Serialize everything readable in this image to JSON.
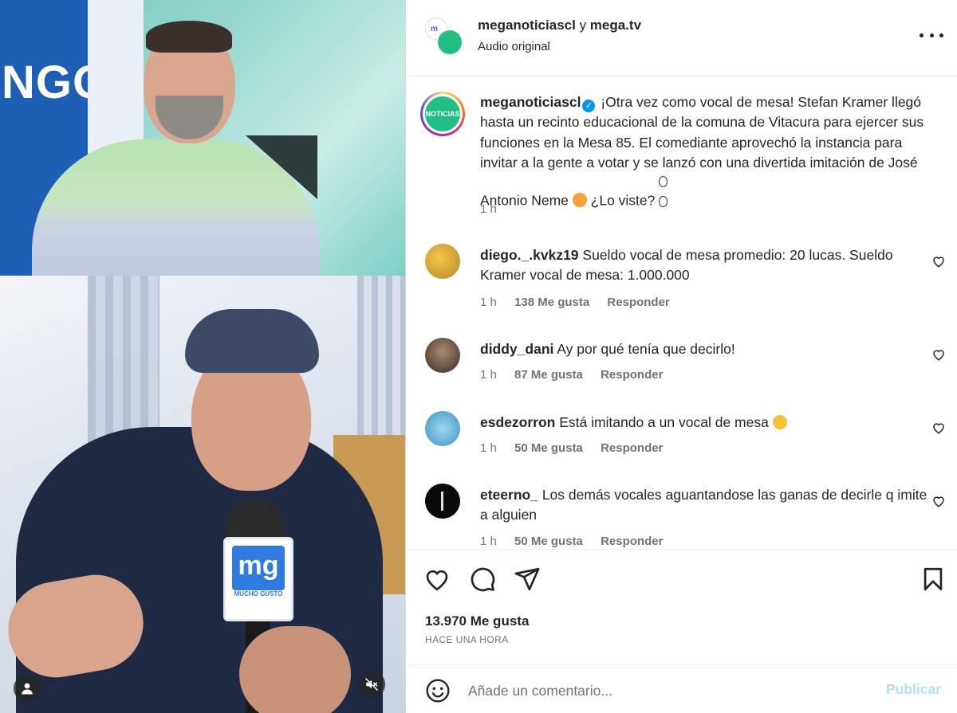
{
  "media": {
    "top_scene_text": "NGO",
    "mic_logo": "mg",
    "mic_sub": "MUCHO GUSTO",
    "user_icon": "user-icon",
    "mute_icon": "muted-speaker-icon"
  },
  "header": {
    "collab_avatar_text": "m",
    "user1": "meganoticiascl",
    "separator": "y",
    "user2": "mega.tv",
    "audio": "Audio original",
    "more_icon": "more-options-icon"
  },
  "caption": {
    "avatar_text": "NOTICIAS",
    "username": "meganoticiascl",
    "text_part1": "¡Otra vez como vocal de mesa! Stefan Kramer llegó hasta un recinto educacional de la comuna de Vitacura para ejercer sus funciones en la Mesa 85. El comediante aprovechó la instancia para invitar a la gente a votar y se lanzó con una divertida imitación de José Antonio Neme",
    "text_part2": "¿Lo viste?",
    "time": "1 h"
  },
  "comments": [
    {
      "username": "diego._.kvkz19",
      "text": "Sueldo vocal de mesa promedio: 20 lucas. Sueldo Kramer vocal de mesa: 1.000.000",
      "time": "1 h",
      "likes": "138 Me gusta",
      "reply": "Responder"
    },
    {
      "username": "diddy_dani",
      "text": "Ay por qué tenía que decirlo!",
      "time": "1 h",
      "likes": "87 Me gusta",
      "reply": "Responder"
    },
    {
      "username": "esdezorron",
      "text": "Está imitando a un vocal de mesa",
      "time": "1 h",
      "likes": "50 Me gusta",
      "reply": "Responder"
    },
    {
      "username": "eteerno_",
      "text": "Los demás vocales aguantandose las ganas de decirle q imite a alguien",
      "time": "1 h",
      "likes": "50 Me gusta",
      "reply": "Responder"
    }
  ],
  "actions": {
    "like_icon": "heart-icon",
    "comment_icon": "comment-icon",
    "share_icon": "send-icon",
    "save_icon": "bookmark-icon",
    "likes": "13.970 Me gusta",
    "time_ago": "HACE UNA HORA"
  },
  "add_comment": {
    "emoji_icon": "smiley-icon",
    "placeholder": "Añade un comentario...",
    "publish": "Publicar"
  },
  "colors": {
    "accent": "#0095f6",
    "publish_disabled": "#b2dffc",
    "brand_green": "#1fbf86"
  }
}
